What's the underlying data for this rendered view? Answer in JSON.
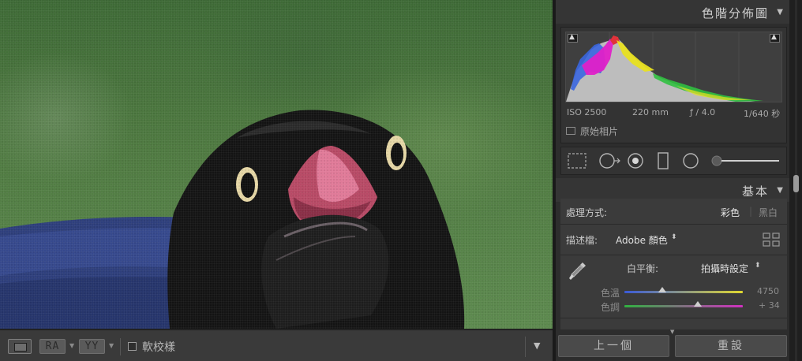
{
  "toolbar": {
    "view_loupe_icon": "loupe-view-icon",
    "ra_label": "RA",
    "yy_label": "YY",
    "soft_proofing_label": "軟校樣",
    "soft_proofing_checked": false
  },
  "histogram": {
    "title": "色階分佈圖",
    "iso": "ISO 2500",
    "focal_length": "220 mm",
    "aperture": "ƒ / 4.0",
    "shutter": "1/640 秒",
    "original_photo_label": "原始相片",
    "colors": {
      "red": "#e0323a",
      "magenta": "#e020c8",
      "blue": "#3a66e0",
      "yellow": "#e8e020",
      "green": "#30c040",
      "gray": "#bdbdbd"
    }
  },
  "tools": [
    "crop-overlay-icon",
    "spot-removal-icon",
    "red-eye-icon",
    "graduated-filter-icon",
    "radial-filter-icon",
    "adjustment-brush-icon"
  ],
  "basic": {
    "title": "基本",
    "treatment_label": "處理方式:",
    "treatment_color": "彩色",
    "treatment_bw": "黑白",
    "profile_label": "描述檔:",
    "profile_value": "Adobe 顏色",
    "wb_label": "白平衡:",
    "wb_value": "拍攝時設定",
    "temp_label": "色溫",
    "temp_value": "4750",
    "temp_level": 0.32,
    "tint_label": "色調",
    "tint_value": "+ 34",
    "tint_level": 0.62
  },
  "nav": {
    "prev_label": "上一個",
    "reset_label": "重設"
  }
}
